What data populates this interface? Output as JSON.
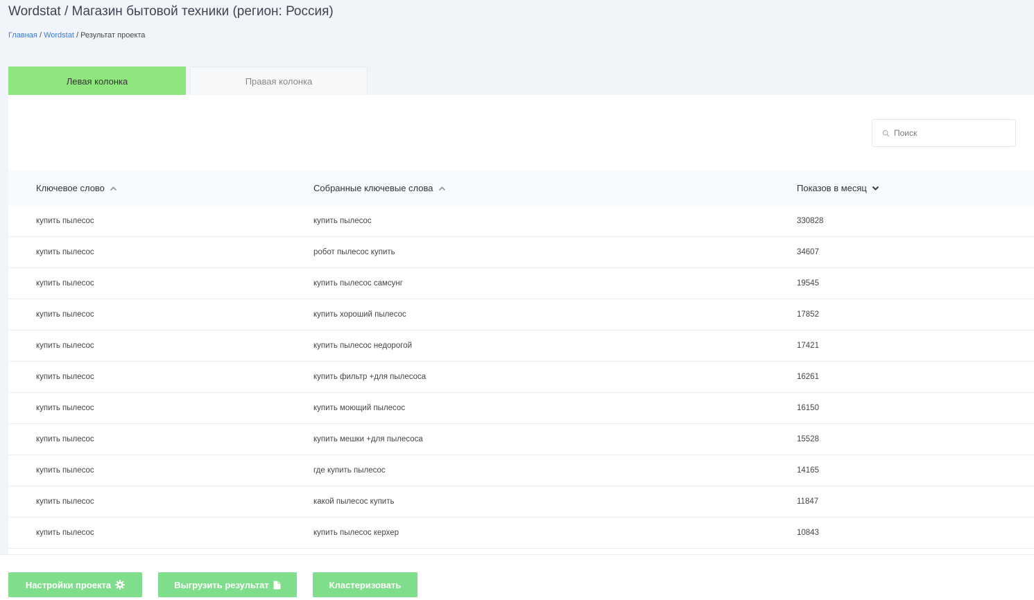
{
  "header": {
    "title": "Wordstat / Магазин бытовой техники (регион: Россия)",
    "breadcrumb": {
      "home": "Главная",
      "sep1": "/",
      "section": "Wordstat",
      "sep2": "/",
      "current": "Результат проекта"
    }
  },
  "tabs": [
    {
      "label": "Левая колонка",
      "active": true
    },
    {
      "label": "Правая колонка",
      "active": false
    }
  ],
  "search": {
    "placeholder": "Поиск",
    "icon": "search-icon"
  },
  "table": {
    "columns": [
      {
        "label": "Ключевое слово",
        "sort_icon": "chevron-up-icon"
      },
      {
        "label": "Собранные ключевые слова",
        "sort_icon": "chevron-up-icon"
      },
      {
        "label": "Показов в месяц",
        "sort_icon": "chevron-down-icon"
      }
    ],
    "rows": [
      {
        "keyword": "купить пылесос",
        "collected": "купить пылесос",
        "impressions": "330828"
      },
      {
        "keyword": "купить пылесос",
        "collected": "робот пылесос купить",
        "impressions": "34607"
      },
      {
        "keyword": "купить пылесос",
        "collected": "купить пылесос самсунг",
        "impressions": "19545"
      },
      {
        "keyword": "купить пылесос",
        "collected": "купить хороший пылесос",
        "impressions": "17852"
      },
      {
        "keyword": "купить пылесос",
        "collected": "купить пылесос недорогой",
        "impressions": "17421"
      },
      {
        "keyword": "купить пылесос",
        "collected": "купить фильтр +для пылесоса",
        "impressions": "16261"
      },
      {
        "keyword": "купить пылесос",
        "collected": "купить моющий пылесос",
        "impressions": "16150"
      },
      {
        "keyword": "купить пылесос",
        "collected": "купить мешки +для пылесоса",
        "impressions": "15528"
      },
      {
        "keyword": "купить пылесос",
        "collected": "где купить пылесос",
        "impressions": "14165"
      },
      {
        "keyword": "купить пылесос",
        "collected": "какой пылесос купить",
        "impressions": "11847"
      },
      {
        "keyword": "купить пылесос",
        "collected": "купить пылесос керхер",
        "impressions": "10843"
      }
    ]
  },
  "footer": {
    "settings_label": "Настройки проекта",
    "settings_icon": "gear-icon",
    "export_label": "Выгрузить результат",
    "export_icon": "file-icon",
    "cluster_label": "Кластеризовать"
  },
  "colors": {
    "accent_green": "#8fe67e",
    "button_green": "#7fde8b",
    "link_blue": "#3a7bd5",
    "background": "#f1f4f8"
  }
}
